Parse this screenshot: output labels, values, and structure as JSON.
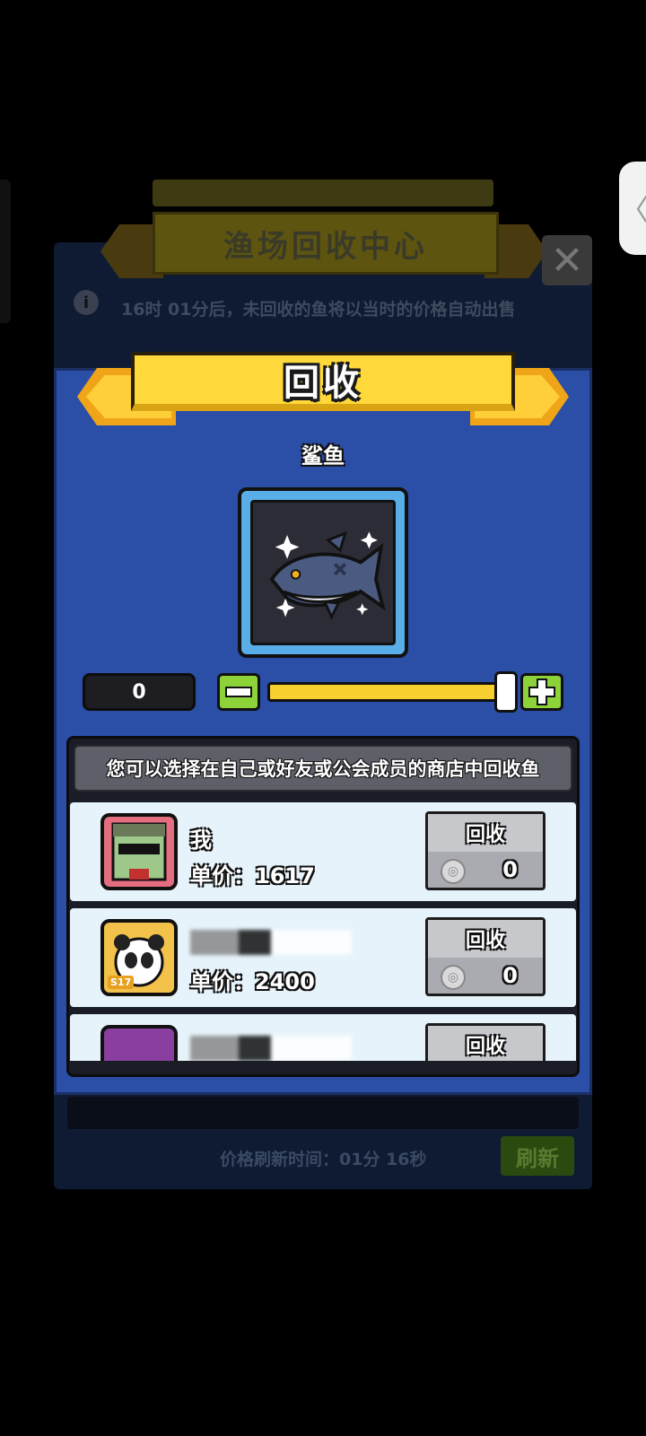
{
  "background_screen": {
    "title": "渔场回收中心",
    "close_symbol": "✕",
    "info_symbol": "i",
    "notice": "16时 01分后，未回收的鱼将以当时的价格自动出售",
    "refresh_time_text": "价格刷新时间：01分 16秒",
    "refresh_button": "刷新"
  },
  "side_tab": {
    "symbol": "〈"
  },
  "dialog": {
    "title": "回收",
    "fish_name": "鲨鱼",
    "quantity": "0",
    "minus_symbol": "−",
    "plus_symbol": "+",
    "slider_value": 1.0,
    "list_header": "您可以选择在自己或好友或公会成员的商店中回收鱼",
    "rows": [
      {
        "name": "我",
        "price_label": "单价：1617",
        "button_label": "回收",
        "coin_count": "0"
      },
      {
        "name": "",
        "price_label": "单价：2400",
        "button_label": "回收",
        "coin_count": "0",
        "level": "S17"
      },
      {
        "name": "",
        "price_label": "",
        "button_label": "回收",
        "coin_count": ""
      }
    ]
  },
  "colors": {
    "dialog_bg": "#2b4ea6",
    "ribbon_yellow": "#ffd93b",
    "button_green": "#8ed23a",
    "slider_yellow": "#f7cf2e",
    "row_bg": "#e6f3fa"
  }
}
